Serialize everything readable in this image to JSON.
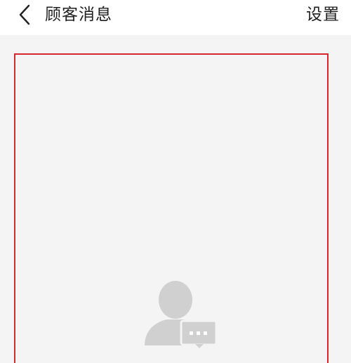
{
  "header": {
    "title": "顾客消息",
    "settings_label": "设置",
    "back_icon": "chevron-left-icon"
  },
  "main": {
    "empty_state_icon": "customer-chat-icon"
  },
  "colors": {
    "background": "#f4f4f4",
    "header_background": "#ffffff",
    "frame_border": "#d8262f",
    "icon_gray": "#d0d0d0"
  }
}
